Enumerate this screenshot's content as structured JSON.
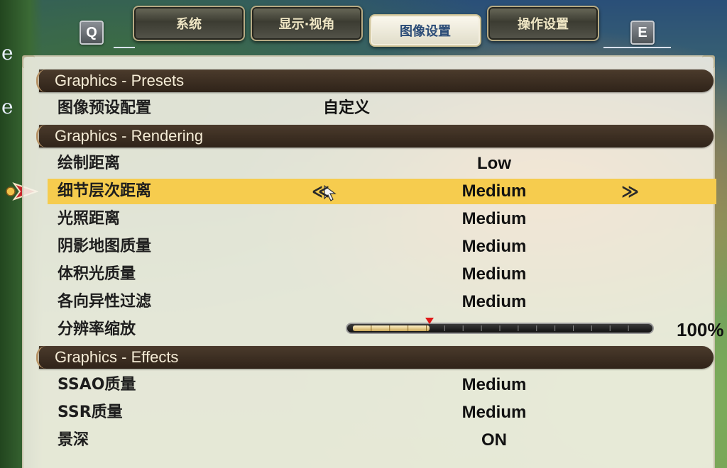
{
  "tabs": {
    "left_key": "Q",
    "right_key": "E",
    "items": [
      {
        "label": "系统"
      },
      {
        "label": "显示·视角"
      },
      {
        "label": "图像设置"
      },
      {
        "label": "操作设置"
      }
    ],
    "active_index": 2
  },
  "sections": [
    {
      "title": "Graphics - Presets"
    },
    {
      "title": "Graphics - Rendering"
    },
    {
      "title": "Graphics - Effects"
    }
  ],
  "settings": {
    "preset": {
      "label": "图像预设配置",
      "value": "自定义"
    },
    "draw_distance": {
      "label": "绘制距离",
      "value": "Low"
    },
    "lod_distance": {
      "label": "细节层次距离",
      "value": "Medium"
    },
    "light_distance": {
      "label": "光照距离",
      "value": "Medium"
    },
    "shadow_quality": {
      "label": "阴影地图质量",
      "value": "Medium"
    },
    "volumetric_light": {
      "label": "体积光质量",
      "value": "Medium"
    },
    "anisotropic": {
      "label": "各向异性过滤",
      "value": "Medium"
    },
    "resolution_scale": {
      "label": "分辨率缩放",
      "value": "100%",
      "fraction": 0.26
    },
    "ssao": {
      "label": "SSAO质量",
      "value": "Medium"
    },
    "ssr": {
      "label": "SSR质量",
      "value": "Medium"
    },
    "dof": {
      "label": "景深",
      "value": "ON"
    }
  },
  "selector": {
    "prev": "≪",
    "next": "≫"
  },
  "background_letters": [
    "e",
    "e"
  ],
  "colors": {
    "highlight": "#f6cc4e",
    "section_bar": "#3b2d21",
    "handle": "#e01818"
  }
}
